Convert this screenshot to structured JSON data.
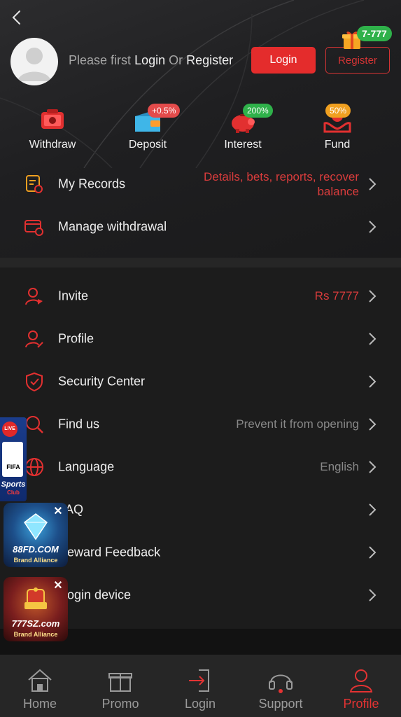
{
  "header": {
    "prompt_prefix": "Please first",
    "prompt_login": "Login",
    "prompt_or": "Or",
    "prompt_register": "Register",
    "login_button": "Login",
    "register_button": "Register",
    "gift_badge": "7-777"
  },
  "quick_actions": [
    {
      "label": "Withdraw",
      "icon": "withdraw-icon",
      "badge": null
    },
    {
      "label": "Deposit",
      "icon": "wallet-icon",
      "badge": "+0.5%",
      "badge_color": "#e34b4b"
    },
    {
      "label": "Interest",
      "icon": "piggy-bank-icon",
      "badge": "200%",
      "badge_color": "#2fb14a"
    },
    {
      "label": "Fund",
      "icon": "fund-icon",
      "badge": "50%",
      "badge_color": "#f0a020"
    }
  ],
  "records": [
    {
      "label": "My Records",
      "value": "Details, bets, reports, recover",
      "value2": "balance"
    },
    {
      "label": "Manage withdrawal"
    }
  ],
  "menu": [
    {
      "label": "Invite",
      "value": "Rs 7777",
      "value_red": true
    },
    {
      "label": "Profile",
      "value": ""
    },
    {
      "label": "Security Center",
      "value": ""
    },
    {
      "label": "Find us",
      "value": "Prevent it from opening"
    },
    {
      "label": "Language",
      "value": "English"
    },
    {
      "label": "AQ",
      "value": ""
    },
    {
      "label": "eward Feedback",
      "value": ""
    },
    {
      "label": "ogin device",
      "value": ""
    }
  ],
  "floating": {
    "sports_live": "LIVE",
    "sports_fifa": "FIFA",
    "sports_label": "Sports",
    "sports_club": "Club",
    "ad1_brand": "88FD.COM",
    "ad1_sub": "Brand Alliance",
    "ad2_brand": "777SZ.com",
    "ad2_sub": "Brand Alliance",
    "close_glyph": "✕"
  },
  "tabs": [
    {
      "label": "Home",
      "icon": "home-icon"
    },
    {
      "label": "Promo",
      "icon": "gift-icon"
    },
    {
      "label": "Login",
      "icon": "login-icon"
    },
    {
      "label": "Support",
      "icon": "headset-icon"
    },
    {
      "label": "Profile",
      "icon": "profile-icon",
      "active": true
    }
  ],
  "colors": {
    "accent": "#e42c2c",
    "background": "#1c1c1c",
    "header": "#2a2a2c",
    "tabbar": "#262626"
  }
}
